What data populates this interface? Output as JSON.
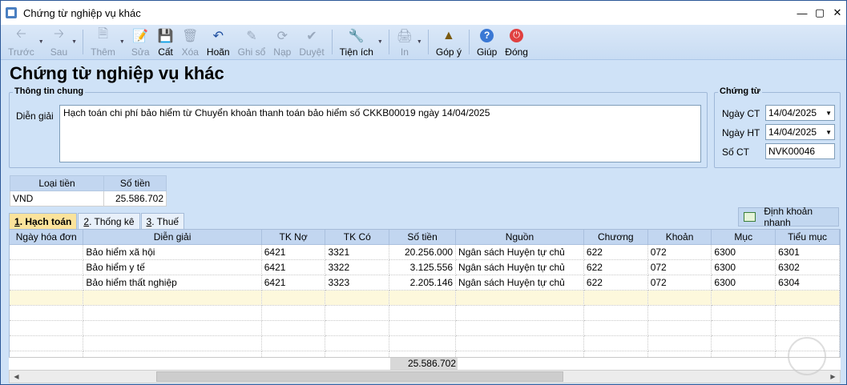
{
  "window": {
    "title": "Chứng từ nghiệp vụ khác"
  },
  "toolbar": {
    "back": "Trước",
    "next": "Sau",
    "add": "Thêm",
    "edit": "Sửa",
    "save": "Cất",
    "delete": "Xóa",
    "undo": "Hoãn",
    "post": "Ghi sổ",
    "reload": "Nạp",
    "approve": "Duyệt",
    "utilities": "Tiện ích",
    "print": "In",
    "feedback": "Góp ý",
    "help": "Giúp",
    "close": "Đóng"
  },
  "page_title": "Chứng từ nghiệp vụ khác",
  "general": {
    "group_label": "Thông tin chung",
    "desc_label": "Diễn giải",
    "desc_value": "Hạch toán chi phí bảo hiểm từ Chuyển khoản thanh toán bảo hiểm số CKKB00019 ngày 14/04/2025"
  },
  "voucher": {
    "group_label": "Chứng từ",
    "date_ct_label": "Ngày CT",
    "date_ct": "14/04/2025",
    "date_ht_label": "Ngày HT",
    "date_ht": "14/04/2025",
    "no_label": "Số CT",
    "no": "NVK00046"
  },
  "currency": {
    "col_type": "Loại tiền",
    "col_amount": "Số tiền",
    "type": "VND",
    "amount": "25.586.702"
  },
  "tabs": [
    {
      "num": "1",
      "label": ". Hạch toán"
    },
    {
      "num": "2",
      "label": ". Thống kê"
    },
    {
      "num": "3",
      "label": ". Thuế"
    }
  ],
  "quick_entry_button": "Định khoản nhanh",
  "grid": {
    "headers": [
      "Ngày hóa đơn",
      "Diễn giải",
      "TK Nợ",
      "TK Có",
      "Số tiền",
      "Nguồn",
      "Chương",
      "Khoản",
      "Mục",
      "Tiểu mục"
    ],
    "rows": [
      [
        "",
        "Bảo hiểm xã hội",
        "6421",
        "3321",
        "20.256.000",
        "Ngân sách Huyện tự chủ",
        "622",
        "072",
        "6300",
        "6301"
      ],
      [
        "",
        "Bảo hiểm y tế",
        "6421",
        "3322",
        "3.125.556",
        "Ngân sách Huyện tự chủ",
        "622",
        "072",
        "6300",
        "6302"
      ],
      [
        "",
        "Bảo hiểm thất nghiệp",
        "6421",
        "3323",
        "2.205.146",
        "Ngân sách Huyện tự chủ",
        "622",
        "072",
        "6300",
        "6304"
      ]
    ],
    "total": "25.586.702"
  },
  "colors": {
    "accent": "#2b5797",
    "tab_active": "#fbe39b"
  }
}
